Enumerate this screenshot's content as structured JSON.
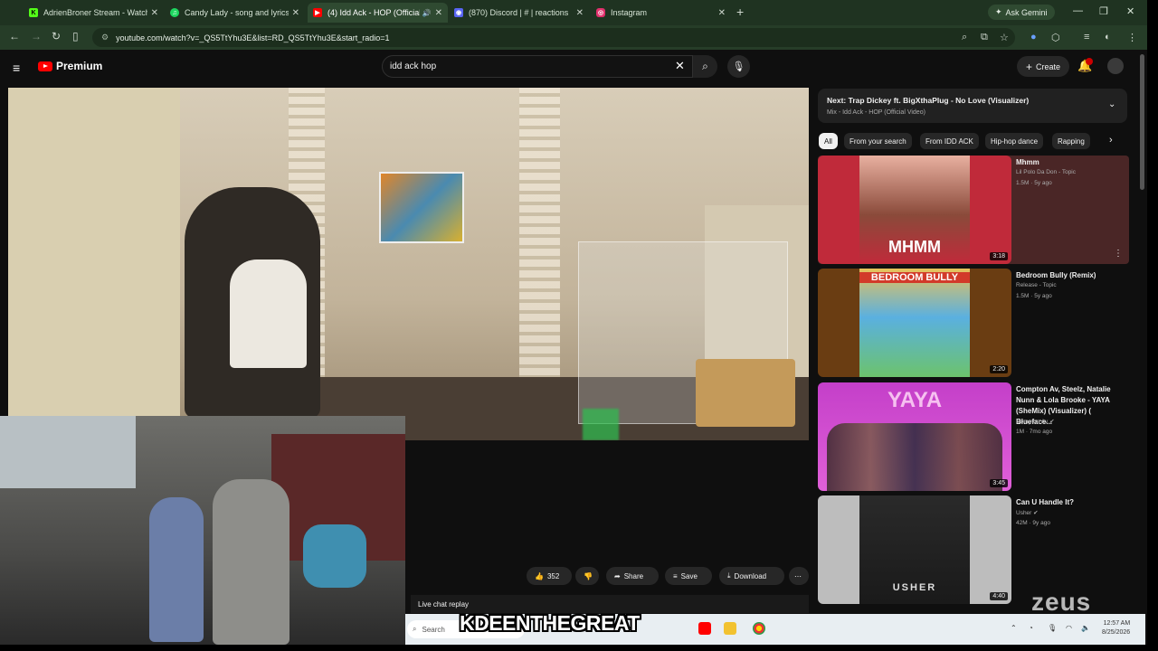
{
  "browser": {
    "tabs": [
      {
        "title": "AdrienBroner Stream - Watch L",
        "favicon_color": "#53fc18",
        "favicon_glyph": "K"
      },
      {
        "title": "Candy Lady - song and lyrics by",
        "favicon_color": "#1ed760",
        "favicon_glyph": "♫"
      },
      {
        "title": "(4) Idd Ack - HOP (Official V",
        "favicon_color": "#ff0000",
        "favicon_glyph": "▶"
      },
      {
        "title": "(870) Discord | # | reactions",
        "favicon_color": "#5865f2",
        "favicon_glyph": "◉"
      },
      {
        "title": "Instagram",
        "favicon_color": "#e1306c",
        "favicon_glyph": "◎"
      }
    ],
    "ask_gemini": "Ask Gemini",
    "url": "youtube.com/watch?v=_QS5TtYhu3E&list=RD_QS5TtYhu3E&start_radio=1"
  },
  "youtube": {
    "brand": "Premium",
    "search_query": "idd ack hop",
    "create_label": "Create",
    "notification_count": "9+",
    "actions": {
      "likes": "352",
      "share": "Share",
      "save": "Save",
      "download": "Download"
    },
    "live_chat": "Live chat replay",
    "up_next": {
      "title": "Next: Trap Dickey ft. BigXthaPlug - No Love (Visualizer)",
      "subtitle": "Mix - Idd Ack - HOP (Official Video)"
    },
    "chips": [
      "All",
      "From your search",
      "From IDD ACK",
      "Hip-hop dance",
      "Rapping"
    ],
    "recommendations": [
      {
        "title": "Mhmm",
        "channel": "Lil Polo Da Don - Topic",
        "meta": "1.5M · 5y ago",
        "duration": "3:18",
        "art_text": "MHMM",
        "bg": "#c02a3a",
        "art": "#e8b0a0"
      },
      {
        "title": "Bedroom Bully (Remix)",
        "channel": "Release - Topic",
        "meta": "1.5M · 5y ago",
        "duration": "2:20",
        "art_text": "BEDROOM BULLY",
        "bg": "#6a3d12",
        "art": "#e9c35a"
      },
      {
        "title": "Compton Av, Steelz, Natalie Nunn & Lola Brooke - YAYA (SheMix) (Visualizer) ( Blueface...",
        "channel": "Compton Av",
        "meta": "1M · 7mo ago",
        "duration": "3:45",
        "art_text": "YAYA",
        "bg": "#c43fc9",
        "art": "#e890e8"
      },
      {
        "title": "Can U Handle It?",
        "channel": "Usher",
        "meta": "42M · 9y ago",
        "duration": "4:40",
        "art_text": "USHER",
        "bg": "#bdbdbd",
        "art": "#1d1d1d"
      }
    ]
  },
  "overlay": {
    "banner": "KDEENTHEGREAT",
    "watermark": "zeus"
  },
  "taskbar": {
    "search_placeholder": "Search",
    "time": "12:57 AM",
    "date": "8/25/2026"
  }
}
